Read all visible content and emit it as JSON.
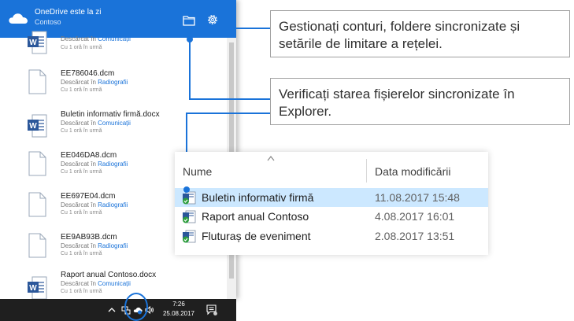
{
  "onedrive": {
    "title": "OneDrive este la zi",
    "subtitle": "Contoso",
    "files": [
      {
        "name": "",
        "action": "Descărcat în ",
        "location": "Comunicații",
        "time": "Cu 1 oră în urmă",
        "icon": "word-doc-icon"
      },
      {
        "name": "EE786046.dcm",
        "action": "Descărcat în ",
        "location": "Radiografii",
        "time": "Cu 1 oră în urmă",
        "icon": "generic-file-icon"
      },
      {
        "name": "Buletin informativ firmă.docx",
        "action": "Descărcat în ",
        "location": "Comunicații",
        "time": "Cu 1 oră în urmă",
        "icon": "word-doc-icon"
      },
      {
        "name": "EE046DA8.dcm",
        "action": "Descărcat în ",
        "location": "Radiografii",
        "time": "Cu 1 oră în urmă",
        "icon": "generic-file-icon"
      },
      {
        "name": "EE697E04.dcm",
        "action": "Descărcat în ",
        "location": "Radiografii",
        "time": "Cu 1 oră în urmă",
        "icon": "generic-file-icon"
      },
      {
        "name": "EE9AB93B.dcm",
        "action": "Descărcat în ",
        "location": "Radiografii",
        "time": "Cu 1 oră în urmă",
        "icon": "generic-file-icon"
      },
      {
        "name": "Raport anual Contoso.docx",
        "action": "Descărcat în ",
        "location": "Comunicații",
        "time": "Cu 1 oră în urmă",
        "icon": "word-doc-icon"
      }
    ]
  },
  "taskbar": {
    "time": "7:26",
    "date": "25.08.2017",
    "icons": [
      "chevron-up-icon",
      "network-icon",
      "onedrive-sync-icon",
      "volume-icon",
      "action-center-icon"
    ]
  },
  "callouts": {
    "accounts": "Gestionați conturi, foldere sincronizate și setările de limitare a rețelei.",
    "explorer": "Verificați starea fișierelor sincronizate în Explorer."
  },
  "explorer": {
    "columns": {
      "name": "Nume",
      "date": "Data modificării"
    },
    "rows": [
      {
        "name": "Buletin informativ firmă",
        "date": "11.08.2017 15:48",
        "selected": true
      },
      {
        "name": "Raport anual Contoso",
        "date": "4.08.2017 16:01",
        "selected": false
      },
      {
        "name": "Fluturaș de eveniment",
        "date": "2.08.2017 13:51",
        "selected": false
      }
    ]
  },
  "colors": {
    "accent": "#1a73d9",
    "selection": "#cce8ff",
    "sync_ok": "#2e9e3e",
    "taskbar": "#1f1f1f"
  }
}
